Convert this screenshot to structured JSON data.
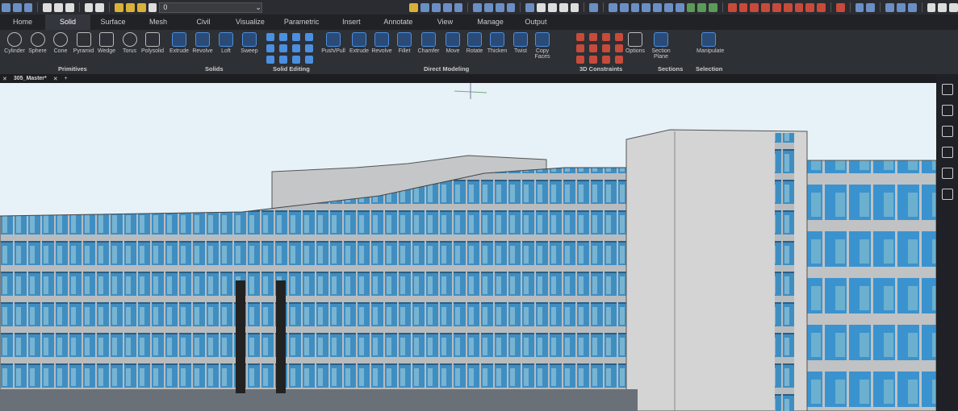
{
  "quick_access": {
    "layer_value": "0"
  },
  "tabs": [
    "Home",
    "Solid",
    "Surface",
    "Mesh",
    "Civil",
    "Visualize",
    "Parametric",
    "Insert",
    "Annotate",
    "View",
    "Manage",
    "Output"
  ],
  "active_tab": "Solid",
  "ribbon": {
    "primitives": [
      "Cylinder",
      "Sphere",
      "Cone",
      "Pyramid",
      "Wedge",
      "Torus",
      "Polysolid"
    ],
    "solids": [
      "Extrude",
      "Revolve",
      "Loft",
      "Sweep"
    ],
    "direct_modeling": [
      "Push/Pull",
      "Extrude",
      "Revolve",
      "Fillet",
      "Chamfer",
      "Move",
      "Rotate",
      "Thicken",
      "Twist",
      "Copy Faces"
    ],
    "options": "Options",
    "section_plane": "Section Plane",
    "manipulate": "Manipulate",
    "groups": {
      "primitives": "Primitives",
      "solids": "Solids",
      "solid_editing": "Solid Editing",
      "direct_modeling": "Direct Modeling",
      "constraints": "3D Constraints",
      "sections": "Sections",
      "selection": "Selection"
    }
  },
  "document_tab": "305_Master*",
  "side_panel": [
    "properties-icon",
    "hatch-icon",
    "formula-icon",
    "structure-icon",
    "cloud-icon",
    "grid-icon"
  ]
}
